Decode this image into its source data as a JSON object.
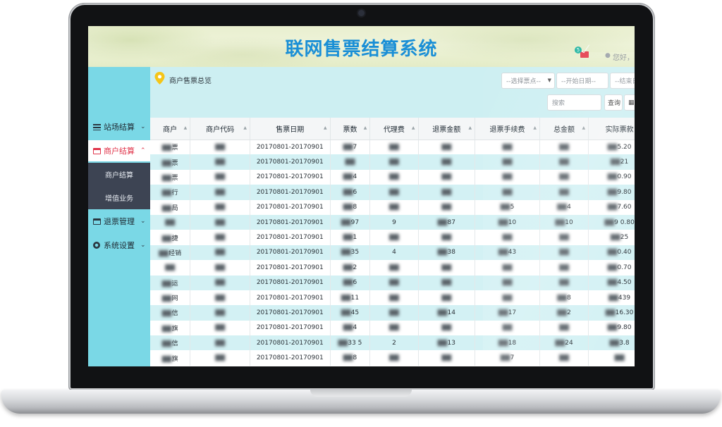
{
  "header": {
    "title": "联网售票结算系统",
    "mail_badge": "5",
    "greeting": "您好，"
  },
  "sidebar": {
    "items": [
      {
        "label": "站场结算",
        "icon": "grid-icon",
        "expanded": false
      },
      {
        "label": "商户结算",
        "icon": "card-icon",
        "expanded": true,
        "active": true
      },
      {
        "label": "退票管理",
        "icon": "card-icon",
        "expanded": false
      },
      {
        "label": "系统设置",
        "icon": "gear-icon",
        "expanded": false
      }
    ],
    "subitems": [
      {
        "label": "商户结算"
      },
      {
        "label": "增值业务"
      }
    ]
  },
  "toolbar": {
    "breadcrumb": "商户售票总览",
    "station_select": "--选择票点--",
    "start_date_placeholder": "--开始日期--",
    "end_date_placeholder": "--结束日期--",
    "search_placeholder": "搜索",
    "query_label": "查询"
  },
  "table": {
    "columns": [
      "商户",
      "商户代码",
      "售票日期",
      "票数",
      "代理费",
      "退票金额",
      "退票手续费",
      "总金额",
      "实际票款"
    ],
    "rows": [
      [
        "票",
        "",
        "20170801-20170901",
        "7",
        "",
        "",
        "",
        "",
        "5.20"
      ],
      [
        "票",
        "",
        "20170801-20170901",
        "",
        "",
        "",
        "",
        "",
        "21"
      ],
      [
        "票",
        "",
        "20170801-20170901",
        "4",
        "",
        "",
        "",
        "",
        "0.90"
      ],
      [
        "行",
        "",
        "20170801-20170901",
        "6",
        "",
        "",
        "",
        "",
        "9.80"
      ],
      [
        "局",
        "",
        "20170801-20170901",
        "8",
        "",
        "",
        "5",
        "4",
        "7.60"
      ],
      [
        "",
        "",
        "20170801-20170901",
        "97",
        "9",
        "87",
        "10",
        "10",
        "9 0.80"
      ],
      [
        "捷",
        "",
        "20170801-20170901",
        "1",
        "",
        "",
        "",
        "",
        "25"
      ],
      [
        "经销",
        "",
        "20170801-20170901",
        "35",
        "4",
        "38",
        "43",
        "",
        "0.40"
      ],
      [
        "",
        "",
        "20170801-20170901",
        "2",
        "",
        "",
        "",
        "",
        "0.70"
      ],
      [
        "运",
        "",
        "20170801-20170901",
        "6",
        "",
        "",
        "",
        "",
        "4.50"
      ],
      [
        "网",
        "",
        "20170801-20170901",
        "11",
        "",
        "",
        "",
        "8",
        "439"
      ],
      [
        "信",
        "",
        "20170801-20170901",
        "45",
        "",
        "14",
        "17",
        "2",
        "16.30"
      ],
      [
        "旗",
        "",
        "20170801-20170901",
        "4",
        "",
        "",
        "",
        "",
        "9.80"
      ],
      [
        "信",
        "",
        "20170801-20170901",
        "33 5",
        "2",
        "13",
        "18",
        "24",
        "3.8"
      ],
      [
        "旗",
        "",
        "20170801-20170901",
        "8",
        "",
        "",
        "7",
        "",
        ""
      ]
    ]
  },
  "colors": {
    "title": "#1a8fd6",
    "sidebar_bg": "#7ad8e6",
    "active_nav": "#e0344a",
    "submenu_bg": "#3d4453",
    "row_alt": "#d3f1f4"
  }
}
